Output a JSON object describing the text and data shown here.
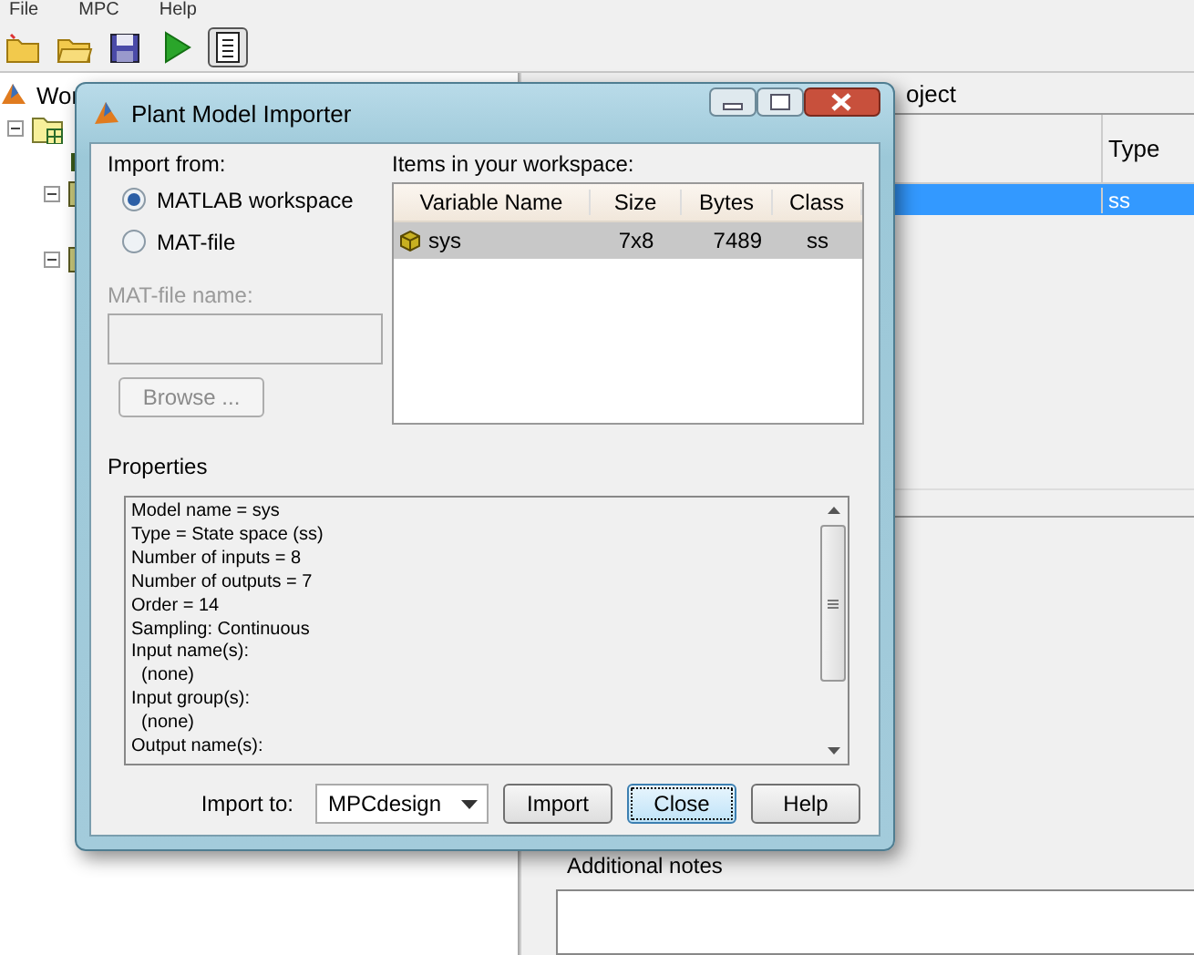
{
  "menu_bar": [
    "File",
    "MPC",
    "Help"
  ],
  "toolbar": [
    {
      "kind": "new-folder",
      "pressed": false
    },
    {
      "kind": "folder",
      "pressed": false
    },
    {
      "kind": "save",
      "pressed": false
    },
    {
      "kind": "run",
      "pressed": false
    },
    {
      "kind": "notes",
      "pressed": true
    }
  ],
  "tree": {
    "label": "Wor",
    "kind": "root",
    "children": [
      {
        "kind": "folder",
        "expanded": true,
        "children": [
          {
            "kind": "leaf"
          },
          {
            "kind": "node",
            "expanded": true
          },
          {
            "kind": "node",
            "expanded": true
          }
        ]
      }
    ]
  },
  "project_panel": {
    "heading": "oject",
    "table": {
      "columns": [
        "Type"
      ],
      "rows": [
        {
          "cells": [
            "ss"
          ],
          "selected": true
        }
      ]
    },
    "notes": {
      "label": "Additional notes"
    }
  },
  "dialog": {
    "title": "Plant Model Importer",
    "import_from": {
      "label": "Import from:",
      "options": [
        {
          "label": "MATLAB workspace",
          "selected": true
        },
        {
          "label": "MAT-file",
          "selected": false
        }
      ]
    },
    "mat_file": {
      "label": "MAT-file name:",
      "disabled": true
    },
    "browse_button": {
      "label": "Browse ...",
      "disabled": true
    },
    "workspace": {
      "label": "Items in your workspace:",
      "columns": [
        "Variable Name",
        "Size",
        "Bytes",
        "Class"
      ],
      "rows": [
        {
          "cells": [
            "sys",
            "7x8",
            "7489",
            "ss"
          ],
          "selected": true
        }
      ]
    },
    "properties": {
      "label": "Properties",
      "lines": [
        "Model name = sys",
        "Type = State space (ss)",
        "Number of inputs = 8",
        "Number of outputs = 7",
        "Order = 14",
        "Sampling: Continuous",
        "Input name(s):",
        "  (none)",
        "Input group(s):",
        "  (none)",
        "Output name(s):"
      ]
    },
    "import_to": {
      "label": "Import to:",
      "value": "MPCdesign"
    },
    "buttons": [
      {
        "label": "Import",
        "default": false
      },
      {
        "label": "Close",
        "default": true
      },
      {
        "label": "Help",
        "default": false
      }
    ]
  }
}
